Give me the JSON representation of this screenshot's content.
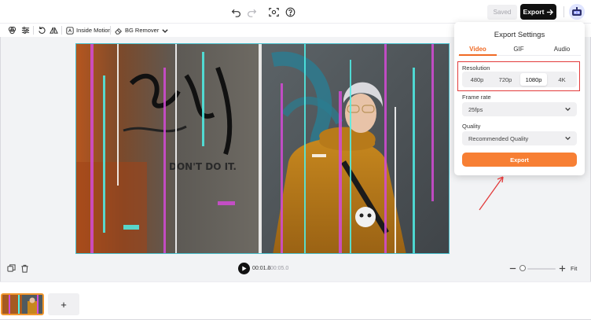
{
  "topbar": {
    "saved_label": "Saved",
    "export_label": "Export",
    "icons": [
      "undo-icon",
      "redo-icon",
      "screenshot-icon",
      "help-icon",
      "arrow-right-icon",
      "avatar"
    ]
  },
  "toolbar": {
    "inside_motion_label": "Inside Motion",
    "bg_remover_label": "BG Remover",
    "icons": [
      "filter-icon",
      "adjust-icon",
      "rotate-icon",
      "flip-icon",
      "motion-icon",
      "eraser-icon",
      "chevron-down-icon"
    ]
  },
  "canvas": {
    "graffiti_text": "DON'T DO IT."
  },
  "export_settings": {
    "title": "Export Settings",
    "tabs": [
      {
        "label": "Video",
        "active": true
      },
      {
        "label": "GIF",
        "active": false
      },
      {
        "label": "Audio",
        "active": false
      }
    ],
    "resolution_label": "Resolution",
    "resolutions": [
      "480p",
      "720p",
      "1080p",
      "4K"
    ],
    "selected_resolution": "1080p",
    "frame_rate_label": "Frame rate",
    "frame_rate_value": "25fps",
    "quality_label": "Quality",
    "quality_value": "Recommended Quality",
    "export_button_label": "Export",
    "accent_color": "#f77f34",
    "highlight_color": "#e23b3b"
  },
  "playback": {
    "current_time": "00:01.6",
    "total_time": "/ 00:05.0",
    "fit_label": "Fit"
  },
  "timeline": {
    "add_label": "+"
  }
}
